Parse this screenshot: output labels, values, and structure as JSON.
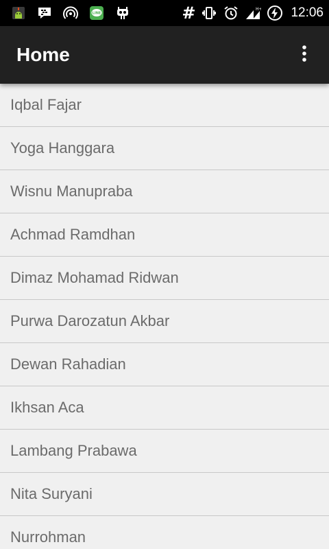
{
  "status_bar": {
    "time": "12:06",
    "hash_symbol": "#",
    "icons": [
      "android-debug-icon",
      "bbm-icon",
      "hotspot-icon",
      "line-icon",
      "custom-icon",
      "hash-icon",
      "vibrate-icon",
      "alarm-icon",
      "signal-icon",
      "battery-charging-icon"
    ]
  },
  "app_bar": {
    "title": "Home",
    "menu_icon": "overflow-menu-icon"
  },
  "list": {
    "items": [
      "Iqbal Fajar",
      "Yoga Hanggara",
      "Wisnu Manupraba",
      "Achmad Ramdhan",
      "Dimaz Mohamad Ridwan",
      "Purwa Darozatun Akbar",
      "Dewan Rahadian",
      "Ikhsan Aca",
      "Lambang Prabawa",
      "Nita Suryani",
      "Nurrohman"
    ]
  },
  "colors": {
    "status_bar": "#000000",
    "app_bar": "#212121",
    "background": "#f0f0f0",
    "list_text": "#6b6b6b",
    "divider": "#c8c8c8"
  }
}
